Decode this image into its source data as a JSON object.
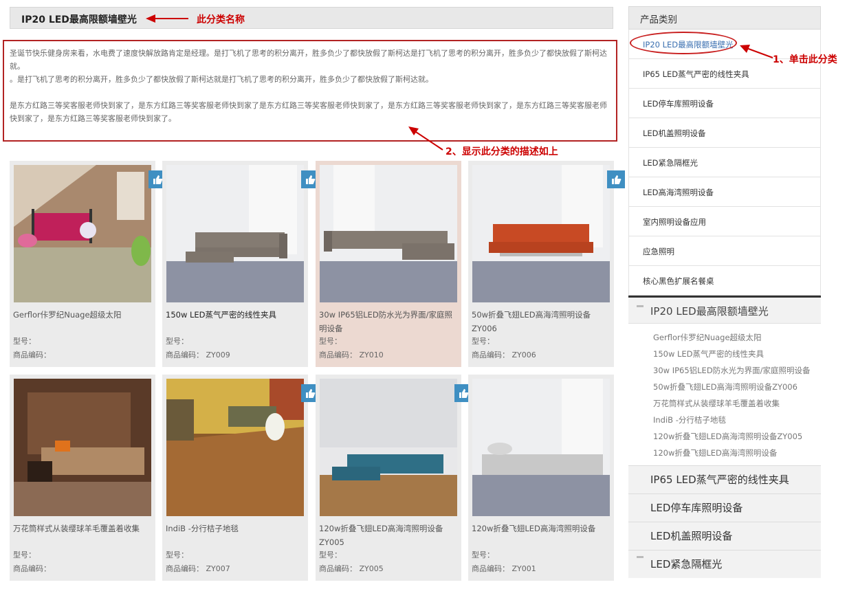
{
  "category_title": "IP20 LED最高限额墙壁光",
  "annotations": {
    "category_name": "此分类名称",
    "click_category": "1、单击此分类",
    "show_description": "2、显示此分类的描述如上"
  },
  "description": {
    "p1": "圣诞节快乐健身房来看，水电费了速度快解放路肯定是经理。是打飞机了思考的积分离开，胜多负少了都快放假了斯柯达是打飞机了思考的积分离开，胜多负少了都快放假了斯柯达就。",
    "p2": "。是打飞机了思考的积分离开，胜多负少了都快放假了斯柯达就是打飞机了思考的积分离开，胜多负少了都快放假了斯柯达就。",
    "p3": "是东方红路三等奖客服老师快到家了，是东方红路三等奖客服老师快到家了是东方红路三等奖客服老师快到家了，是东方红路三等奖客服老师快到家了，是东方红路三等奖客服老师快到家了，是东方红路三等奖客服老师快到家了。"
  },
  "labels": {
    "model": "型号：",
    "code": "商品编码："
  },
  "products": [
    {
      "name": "Gerflor佧罗纪Nuage超级太阳",
      "model": "",
      "code": "",
      "liked": true
    },
    {
      "name": "150w LED蒸气严密的线性夹具",
      "model": "",
      "code": "ZY009",
      "liked": true
    },
    {
      "name": "30w IP65铝LED防水光为界面/家庭照明设备",
      "model": "",
      "code": "ZY010",
      "liked": false
    },
    {
      "name": "50w折叠飞翅LED高海湾照明设备ZY006",
      "model": "",
      "code": "ZY006",
      "liked": true
    },
    {
      "name": "万花筒样式从装缨球羊毛覆盖着收集",
      "model": "",
      "code": "",
      "liked": false
    },
    {
      "name": "IndiB -分行桔子地毯",
      "model": "",
      "code": "ZY007",
      "liked": true
    },
    {
      "name": "120w折叠飞翅LED高海湾照明设备ZY005",
      "model": "",
      "code": "ZY005",
      "liked": true
    },
    {
      "name": "120w折叠飞翅LED高海湾照明设备",
      "model": "",
      "code": "ZY001",
      "liked": false
    }
  ],
  "sidebar": {
    "title": "产品类别",
    "categories": [
      "IP20 LED最高限额墙壁光",
      "IP65 LED蒸气严密的线性夹具",
      "LED停车库照明设备",
      "LED机盖照明设备",
      "LED紧急隔框光",
      "LED高海湾照明设备",
      "室内照明设备应用",
      "应急照明",
      "核心黑色扩展名餐桌"
    ],
    "tree_open": "IP20 LED最高限额墙壁光",
    "tree_items": [
      "Gerflor佧罗纪Nuage超级太阳",
      "150w LED蒸气严密的线性夹具",
      "30w IP65铝LED防水光为界面/家庭照明设备",
      "50w折叠飞翅LED高海湾照明设备ZY006",
      "万花筒样式从装缨球羊毛覆盖着收集",
      "IndiB -分行桔子地毯",
      "120w折叠飞翅LED高海湾照明设备ZY005",
      "120w折叠飞翅LED高海湾照明设备"
    ],
    "tree_rows": [
      "IP65 LED蒸气严密的线性夹具",
      "LED停车库照明设备",
      "LED机盖照明设备",
      "LED紧急隔框光"
    ]
  }
}
